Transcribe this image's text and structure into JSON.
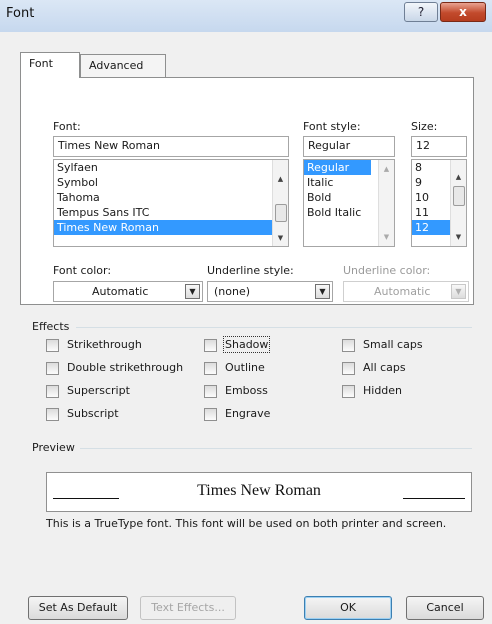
{
  "window": {
    "title": "Font",
    "help_label": "?",
    "close_label": "x"
  },
  "tabs": [
    {
      "label": "Font"
    },
    {
      "label": "Advanced"
    }
  ],
  "font": {
    "label": "Font:",
    "value": "Times New Roman",
    "items": [
      "Sylfaen",
      "Symbol",
      "Tahoma",
      "Tempus Sans ITC",
      "Times New Roman"
    ],
    "selected": "Times New Roman"
  },
  "style": {
    "label": "Font style:",
    "value": "Regular",
    "items": [
      "Regular",
      "Italic",
      "Bold",
      "Bold Italic"
    ],
    "selected": "Regular"
  },
  "size": {
    "label": "Size:",
    "value": "12",
    "items": [
      "8",
      "9",
      "10",
      "11",
      "12"
    ],
    "selected": "12"
  },
  "font_color": {
    "label": "Font color:",
    "value": "Automatic"
  },
  "underline_style": {
    "label": "Underline style:",
    "value": "(none)"
  },
  "underline_color": {
    "label": "Underline color:",
    "value": "Automatic"
  },
  "effects": {
    "title": "Effects",
    "items": [
      "Strikethrough",
      "Double strikethrough",
      "Superscript",
      "Subscript",
      "Shadow",
      "Outline",
      "Emboss",
      "Engrave",
      "Small caps",
      "All caps",
      "Hidden"
    ]
  },
  "preview": {
    "title": "Preview",
    "sample": "Times New Roman",
    "note": "This is a TrueType font. This font will be used on both printer and screen."
  },
  "buttons": {
    "set_default": "Set As Default",
    "text_effects": "Text Effects...",
    "ok": "OK",
    "cancel": "Cancel"
  },
  "icons": {
    "dropdown": "chevron-down-icon",
    "scroll_up": "arrow-up-icon",
    "scroll_down": "arrow-down-icon"
  },
  "colors": {
    "selection": "#3399ff",
    "close_button": "#c24a2c"
  }
}
